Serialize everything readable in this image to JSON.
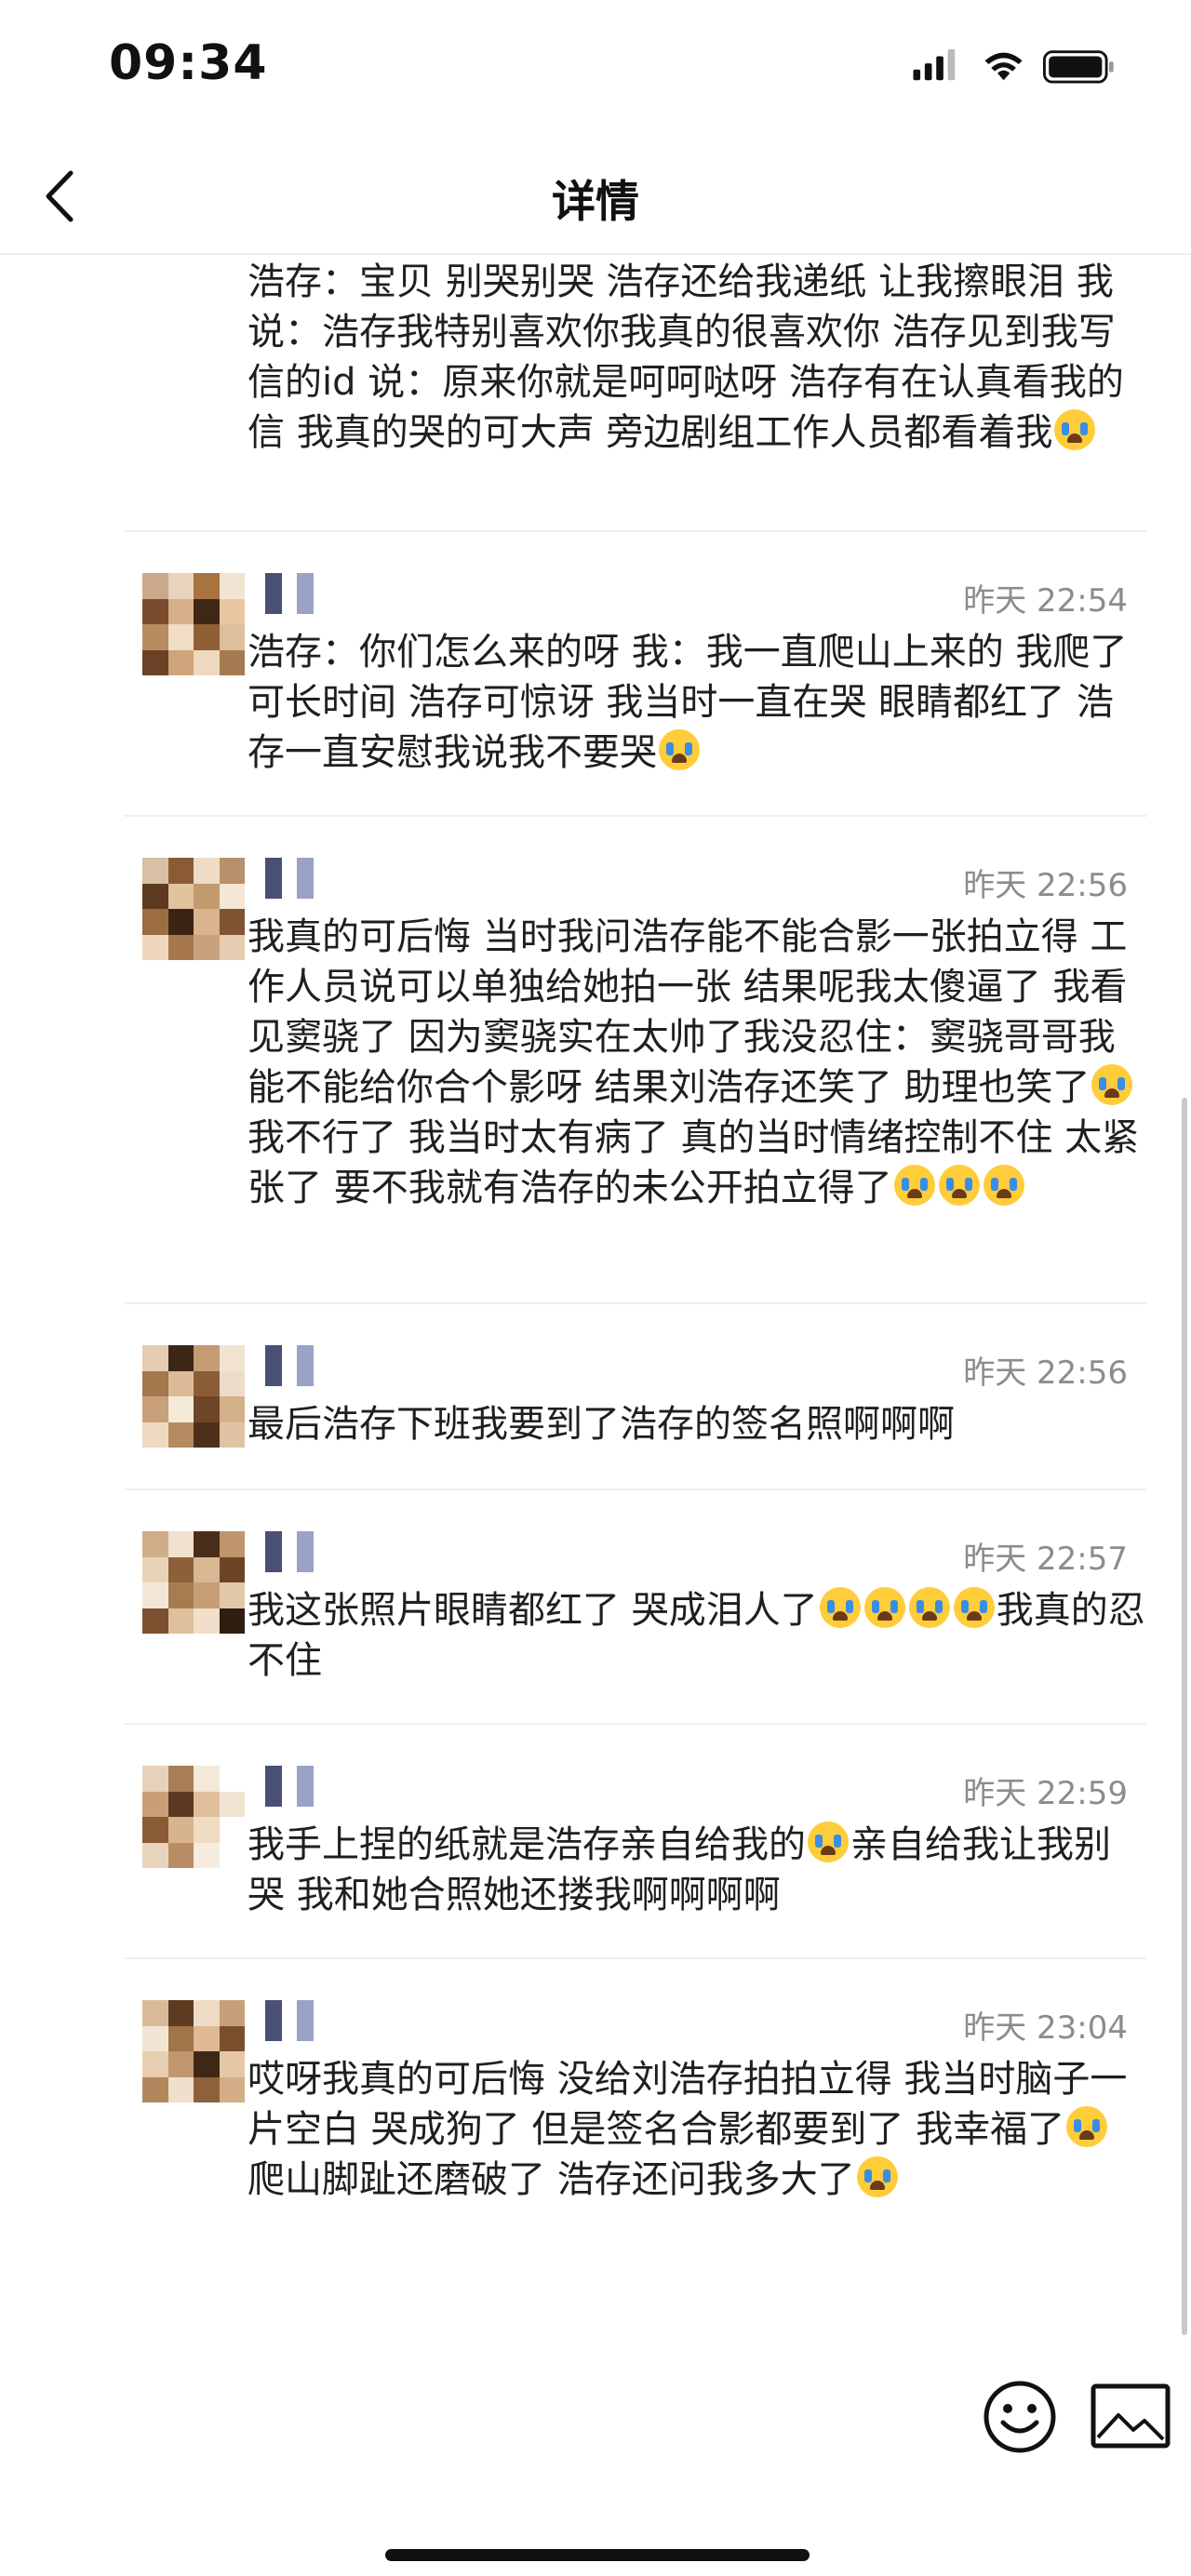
{
  "status_bar": {
    "time": "09:34"
  },
  "nav": {
    "title": "详情"
  },
  "messages": [
    {
      "time": "",
      "text": "浩存：宝贝 别哭别哭 浩存还给我递纸 让我擦眼泪 我说：浩存我特别喜欢你我真的很喜欢你 浩存见到我写信的id 说：原来你就是呵呵哒呀 浩存有在认真看我的信 我真的哭的可大声 旁边剧组工作人员都看着我"
    },
    {
      "time": "昨天 22:54",
      "text": "浩存：你们怎么来的呀 我：我一直爬山上来的 我爬了可长时间 浩存可惊讶 我当时一直在哭 眼睛都红了 浩存一直安慰我说我不要哭"
    },
    {
      "time": "昨天 22:56",
      "text_a": "我真的可后悔 当时我问浩存能不能合影一张拍立得 工作人员说可以单独给她拍一张 结果呢我太傻逼了 我看见窦骁了 因为窦骁实在太帅了我没忍住：窦骁哥哥我能不能给你合个影呀 结果刘浩存还笑了 助理也笑了",
      "text_b": "我不行了 我当时太有病了 真的当时情绪控制不住 太紧张了 要不我就有浩存的未公开拍立得了"
    },
    {
      "time": "昨天 22:56",
      "text": "最后浩存下班我要到了浩存的签名照啊啊啊"
    },
    {
      "time": "昨天 22:57",
      "text_a": "我这张照片眼睛都红了 哭成泪人了",
      "text_b": "我真的忍不住"
    },
    {
      "time": "昨天 22:59",
      "text_a": "我手上捏的纸就是浩存亲自给我的",
      "text_b": "亲自给我让我别哭 我和她合照她还搂我啊啊啊啊"
    },
    {
      "time": "昨天 23:04",
      "text_a": "哎呀我真的可后悔 没给刘浩存拍拍立得 我当时脑子一片空白 哭成狗了 但是签名合影都要到了 我幸福了",
      "text_b": "爬山脚趾还磨破了 浩存还问我多大了"
    }
  ],
  "icons": {
    "back": "chevron-left-icon",
    "emoji_button": "smiley-icon",
    "image_button": "image-icon",
    "crying_emoji": "loudly-crying-face-icon",
    "signal": "cellular-signal-icon",
    "wifi": "wifi-icon",
    "battery": "battery-icon"
  },
  "colors": {
    "background": "#ffffff",
    "text": "#1f1f1f",
    "timestamp": "#8c8c8c",
    "divider": "#eeeeee"
  }
}
